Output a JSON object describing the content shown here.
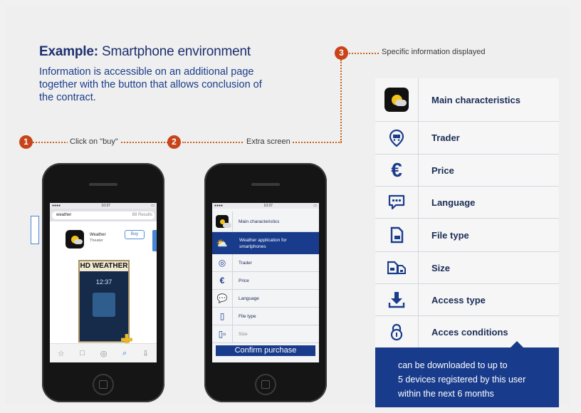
{
  "header": {
    "title_bold": "Example:",
    "title_rest": " Smartphone environment",
    "subtitle": "Information is accessible on an additional page together with the button that allows conclusion of the contract."
  },
  "steps": [
    {
      "number": "1",
      "label": "Click on \"buy\""
    },
    {
      "number": "2",
      "label": "Extra screen"
    },
    {
      "number": "3",
      "label": "Specific information displayed"
    }
  ],
  "phone1": {
    "search_text": "weather",
    "search_results": "89 Results",
    "app_name": "Weather",
    "app_sub": "Theater",
    "buy_label": "Buy",
    "hd_title": "HD WEATHER",
    "hd_time": "12:37",
    "tabs": [
      "☆",
      "□",
      "◎",
      "⌕",
      "⇩"
    ]
  },
  "phone2": {
    "main_label": "Main characteristics",
    "highlight_label": "Weather application for smartphones",
    "rows": [
      "Trader",
      "Price",
      "Language",
      "File type",
      "Size"
    ],
    "confirm_label": "Confirm purchase"
  },
  "panel": {
    "rows": [
      {
        "label": "Main characteristics",
        "icon": "weather-app-icon"
      },
      {
        "label": "Trader",
        "icon": "trader-icon"
      },
      {
        "label": "Price",
        "icon": "euro-icon"
      },
      {
        "label": "Language",
        "icon": "speech-bubble-icon"
      },
      {
        "label": "File type",
        "icon": "file-icon"
      },
      {
        "label": "Size",
        "icon": "size-icon"
      },
      {
        "label": "Access type",
        "icon": "download-icon"
      },
      {
        "label": "Acces conditions",
        "icon": "lock-icon"
      }
    ],
    "info_lines": [
      "can be downloaded to up to",
      "5 devices registered by this user",
      "within the next 6 months"
    ]
  },
  "colors": {
    "accent_blue": "#183b8c",
    "step_orange": "#c8431a",
    "text_blue": "#1a3d8c"
  }
}
